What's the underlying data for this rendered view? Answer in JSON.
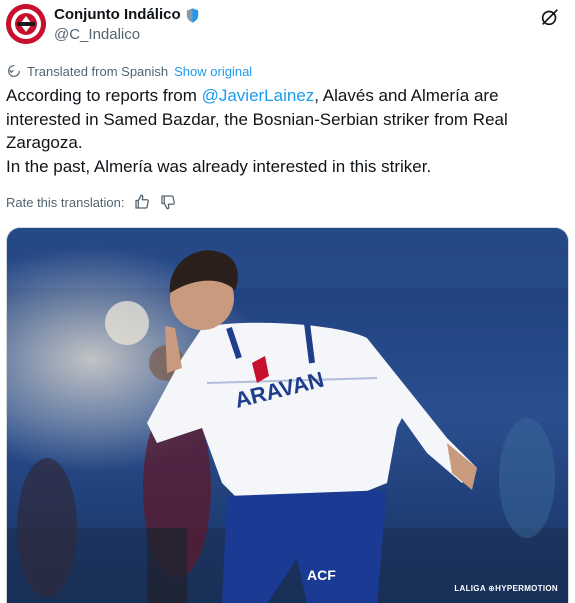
{
  "author": {
    "display_name": "Conjunto Indálico",
    "handle": "@C_Indalico",
    "avatar_text": "CONJUNTO INDÁLICO",
    "verified_icon": "shield-verified-icon"
  },
  "grok_button": {
    "icon": "grok-icon"
  },
  "translation": {
    "notice": "Translated from Spanish",
    "show_original": "Show original",
    "rate_label": "Rate this translation:",
    "thumbs_up_icon": "thumbs-up-icon",
    "thumbs_down_icon": "thumbs-down-icon"
  },
  "tweet": {
    "line1_pre": "According to reports from ",
    "mention": "@JavierLainez",
    "line1_post": ", Alavés and Almería are interested in Samed Bazdar, the Bosnian-Serbian striker from Real Zaragoza.",
    "line2": "In the past, Almería was already interested in this striker."
  },
  "media": {
    "jersey_text": "ARAVAN",
    "sleeve_text": "ACF",
    "watermark": "LALIGA ⊕HYPERMOTION"
  },
  "colors": {
    "accent": "#1d9bf0",
    "text": "#0f1419",
    "muted": "#536471",
    "avatar_red": "#c8102e"
  }
}
